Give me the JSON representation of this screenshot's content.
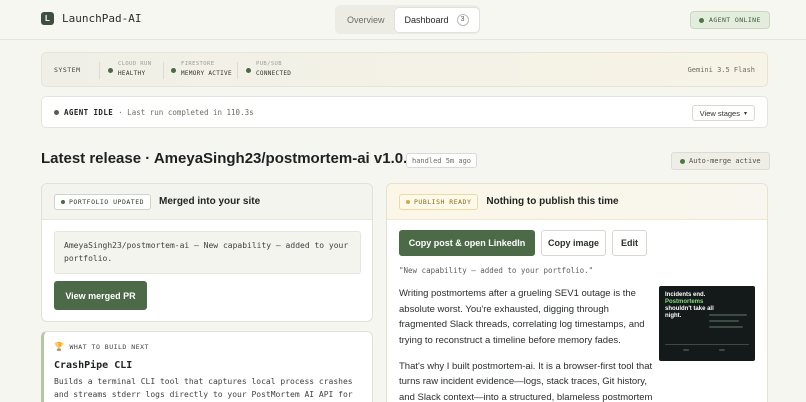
{
  "header": {
    "logo_letter": "L",
    "app_name": "LaunchPad-AI",
    "tabs": [
      {
        "label": "Overview"
      },
      {
        "label": "Dashboard",
        "count": "3"
      }
    ],
    "status": "AGENT ONLINE"
  },
  "system": {
    "label": "SYSTEM",
    "items": [
      {
        "key": "CLOUD RUN",
        "value": "HEALTHY"
      },
      {
        "key": "FIRESTORE",
        "value": "MEMORY ACTIVE"
      },
      {
        "key": "PUB/SUB",
        "value": "CONNECTED"
      }
    ],
    "model": "Gemini 3.5 Flash"
  },
  "agent": {
    "title": "AGENT IDLE",
    "text": "· Last run completed in 110.3s",
    "stages_button": "View stages",
    "stages_chevron": "▾"
  },
  "release": {
    "title": "Latest release · AmeyaSingh23/postmortem-ai v1.0.0",
    "handled": "handled 5m ago",
    "automerge": "Auto-merge active"
  },
  "portfolio": {
    "badge": "PORTFOLIO UPDATED",
    "title": "Merged into your site",
    "message": "AmeyaSingh23/postmortem-ai — New capability — added to your portfolio.",
    "button": "View merged PR"
  },
  "build_next": {
    "label": "WHAT TO BUILD NEXT",
    "title": "CrashPipe CLI",
    "description": "Builds a terminal CLI tool that captures local process crashes and streams stderr logs directly to your PostMortem AI API for"
  },
  "publish": {
    "badge": "PUBLISH READY",
    "title": "Nothing to publish this time",
    "primary_button": "Copy post & open LinkedIn",
    "copy_image_button": "Copy image",
    "edit_button": "Edit",
    "quote": "\"New capability — added to your portfolio.\"",
    "paragraphs": [
      "Writing postmortems after a grueling SEV1 outage is the absolute worst. You're exhausted, digging through fragmented Slack threads, correlating log timestamps, and trying to reconstruct a timeline before memory fades.",
      "That's why I built postmortem-ai. It is a browser-first tool that turns raw incident evidence—logs, stack traces, Git history, and Slack context—into a structured, blameless postmortem"
    ],
    "thumbnail": {
      "line1": "Incidents end.",
      "line2": "Postmortems",
      "line3": "shouldn't take all",
      "line4": "night."
    }
  },
  "colors": {
    "accent_green": "#4d6a48",
    "online_bg": "#e4ecdd",
    "publish_amber": "#d4a84a"
  }
}
